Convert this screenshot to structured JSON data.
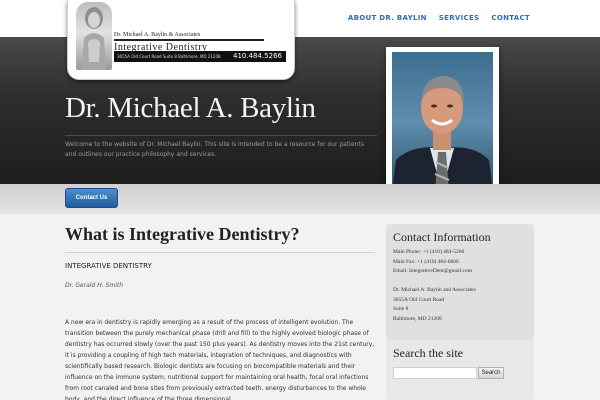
{
  "nav": {
    "items": [
      {
        "label": "ABOUT DR. BAYLIN"
      },
      {
        "label": "SERVICES"
      },
      {
        "label": "CONTACT"
      }
    ]
  },
  "logo": {
    "name": "Dr. Michael A. Baylin & Associates",
    "title": "Integrative Dentistry",
    "address": "3655A Old Court Road Suite 8 Baltimore, MD 21208",
    "phone": "410.484.5266"
  },
  "hero": {
    "title": "Dr. Michael A. Baylin",
    "intro": "Welcome to the website of Dr. Michael Baylin. This site is intended to be a resource for our patients and outlines our practice philosophy and services."
  },
  "contact_button": "Contact Us",
  "main": {
    "title": "What is Integrative Dentistry?",
    "subhead": "INTEGRATIVE DENTISTRY",
    "author": "Dr. Gerald H. Smith",
    "body": "A new era in dentistry is rapidly emerging as a result of the process of intelligent evolution. The transition between the purely mechanical phase (drill and fill) to the highly evolved biologic phase of dentistry has occurred slowly (over the past 150 plus years). As dentistry moves into the 21st century, it is providing a coupling of high tech materials, integration of techniques, and diagnostics with scientifically based research. Biologic dentists are focusing on biocompatible materials and their influence on the immune system, nutritional support for maintaining oral health, focal oral infections from root canaled and bone sites from previously extracted teeth, energy disturbances to the whole body, and the direct influence of the three dimensional"
  },
  "sidebar": {
    "contact": {
      "heading": "Contact Information",
      "phone": "Main Phone: +1 (410) 484-5266",
      "fax": "Main Fax: +1 (410) 484-6606",
      "email": "Email: IntegrativeDent@gmail.com",
      "practice": "Dr. Michael A. Baylin and Associates",
      "street": "3655A Old Court Road",
      "suite": "Suite 8",
      "city": "Baltimore, MD 21208"
    },
    "search": {
      "heading": "Search the site",
      "button": "Search",
      "placeholder": ""
    }
  }
}
